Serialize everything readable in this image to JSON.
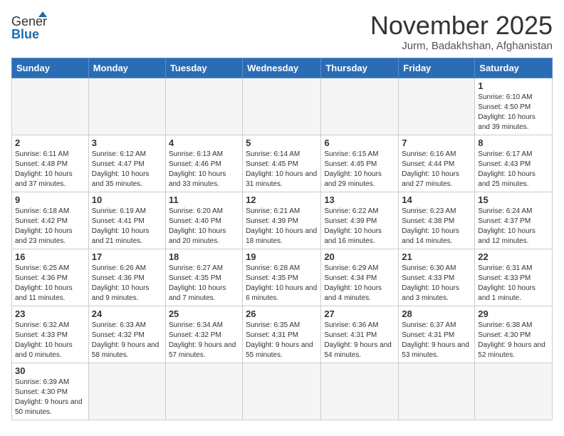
{
  "header": {
    "title": "November 2025",
    "subtitle": "Jurm, Badakhshan, Afghanistan"
  },
  "logo": {
    "line1": "General",
    "line2": "Blue"
  },
  "days_of_week": [
    "Sunday",
    "Monday",
    "Tuesday",
    "Wednesday",
    "Thursday",
    "Friday",
    "Saturday"
  ],
  "weeks": [
    [
      {
        "day": "",
        "info": ""
      },
      {
        "day": "",
        "info": ""
      },
      {
        "day": "",
        "info": ""
      },
      {
        "day": "",
        "info": ""
      },
      {
        "day": "",
        "info": ""
      },
      {
        "day": "",
        "info": ""
      },
      {
        "day": "1",
        "info": "Sunrise: 6:10 AM\nSunset: 4:50 PM\nDaylight: 10 hours and 39 minutes."
      }
    ],
    [
      {
        "day": "2",
        "info": "Sunrise: 6:11 AM\nSunset: 4:48 PM\nDaylight: 10 hours and 37 minutes."
      },
      {
        "day": "3",
        "info": "Sunrise: 6:12 AM\nSunset: 4:47 PM\nDaylight: 10 hours and 35 minutes."
      },
      {
        "day": "4",
        "info": "Sunrise: 6:13 AM\nSunset: 4:46 PM\nDaylight: 10 hours and 33 minutes."
      },
      {
        "day": "5",
        "info": "Sunrise: 6:14 AM\nSunset: 4:45 PM\nDaylight: 10 hours and 31 minutes."
      },
      {
        "day": "6",
        "info": "Sunrise: 6:15 AM\nSunset: 4:45 PM\nDaylight: 10 hours and 29 minutes."
      },
      {
        "day": "7",
        "info": "Sunrise: 6:16 AM\nSunset: 4:44 PM\nDaylight: 10 hours and 27 minutes."
      },
      {
        "day": "8",
        "info": "Sunrise: 6:17 AM\nSunset: 4:43 PM\nDaylight: 10 hours and 25 minutes."
      }
    ],
    [
      {
        "day": "9",
        "info": "Sunrise: 6:18 AM\nSunset: 4:42 PM\nDaylight: 10 hours and 23 minutes."
      },
      {
        "day": "10",
        "info": "Sunrise: 6:19 AM\nSunset: 4:41 PM\nDaylight: 10 hours and 21 minutes."
      },
      {
        "day": "11",
        "info": "Sunrise: 6:20 AM\nSunset: 4:40 PM\nDaylight: 10 hours and 20 minutes."
      },
      {
        "day": "12",
        "info": "Sunrise: 6:21 AM\nSunset: 4:39 PM\nDaylight: 10 hours and 18 minutes."
      },
      {
        "day": "13",
        "info": "Sunrise: 6:22 AM\nSunset: 4:39 PM\nDaylight: 10 hours and 16 minutes."
      },
      {
        "day": "14",
        "info": "Sunrise: 6:23 AM\nSunset: 4:38 PM\nDaylight: 10 hours and 14 minutes."
      },
      {
        "day": "15",
        "info": "Sunrise: 6:24 AM\nSunset: 4:37 PM\nDaylight: 10 hours and 12 minutes."
      }
    ],
    [
      {
        "day": "16",
        "info": "Sunrise: 6:25 AM\nSunset: 4:36 PM\nDaylight: 10 hours and 11 minutes."
      },
      {
        "day": "17",
        "info": "Sunrise: 6:26 AM\nSunset: 4:36 PM\nDaylight: 10 hours and 9 minutes."
      },
      {
        "day": "18",
        "info": "Sunrise: 6:27 AM\nSunset: 4:35 PM\nDaylight: 10 hours and 7 minutes."
      },
      {
        "day": "19",
        "info": "Sunrise: 6:28 AM\nSunset: 4:35 PM\nDaylight: 10 hours and 6 minutes."
      },
      {
        "day": "20",
        "info": "Sunrise: 6:29 AM\nSunset: 4:34 PM\nDaylight: 10 hours and 4 minutes."
      },
      {
        "day": "21",
        "info": "Sunrise: 6:30 AM\nSunset: 4:33 PM\nDaylight: 10 hours and 3 minutes."
      },
      {
        "day": "22",
        "info": "Sunrise: 6:31 AM\nSunset: 4:33 PM\nDaylight: 10 hours and 1 minute."
      }
    ],
    [
      {
        "day": "23",
        "info": "Sunrise: 6:32 AM\nSunset: 4:33 PM\nDaylight: 10 hours and 0 minutes."
      },
      {
        "day": "24",
        "info": "Sunrise: 6:33 AM\nSunset: 4:32 PM\nDaylight: 9 hours and 58 minutes."
      },
      {
        "day": "25",
        "info": "Sunrise: 6:34 AM\nSunset: 4:32 PM\nDaylight: 9 hours and 57 minutes."
      },
      {
        "day": "26",
        "info": "Sunrise: 6:35 AM\nSunset: 4:31 PM\nDaylight: 9 hours and 55 minutes."
      },
      {
        "day": "27",
        "info": "Sunrise: 6:36 AM\nSunset: 4:31 PM\nDaylight: 9 hours and 54 minutes."
      },
      {
        "day": "28",
        "info": "Sunrise: 6:37 AM\nSunset: 4:31 PM\nDaylight: 9 hours and 53 minutes."
      },
      {
        "day": "29",
        "info": "Sunrise: 6:38 AM\nSunset: 4:30 PM\nDaylight: 9 hours and 52 minutes."
      }
    ],
    [
      {
        "day": "30",
        "info": "Sunrise: 6:39 AM\nSunset: 4:30 PM\nDaylight: 9 hours and 50 minutes."
      },
      {
        "day": "",
        "info": ""
      },
      {
        "day": "",
        "info": ""
      },
      {
        "day": "",
        "info": ""
      },
      {
        "day": "",
        "info": ""
      },
      {
        "day": "",
        "info": ""
      },
      {
        "day": "",
        "info": ""
      }
    ]
  ]
}
